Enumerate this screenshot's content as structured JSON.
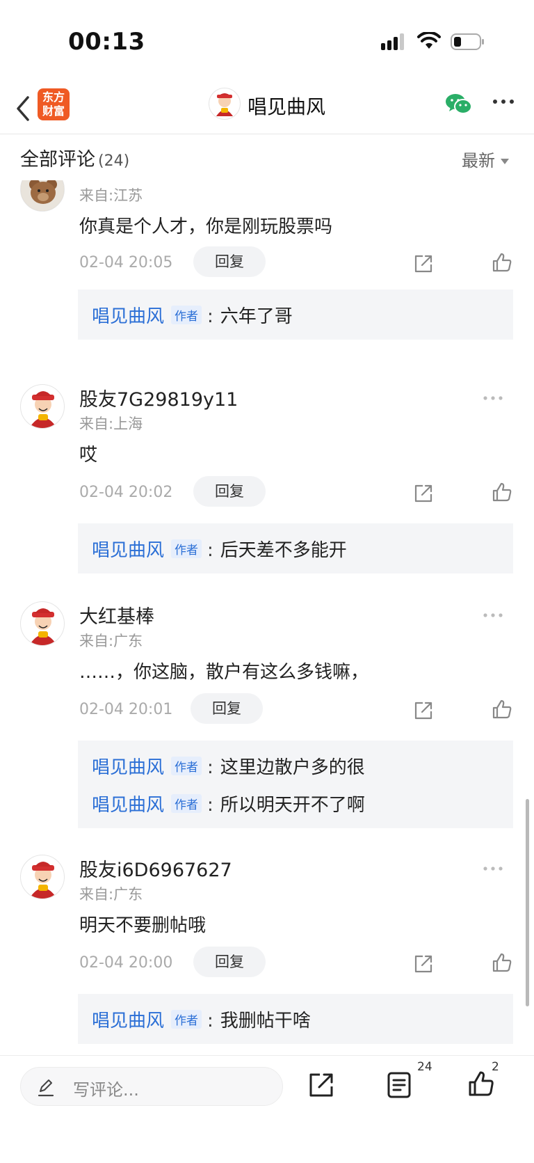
{
  "status": {
    "time": "00:13"
  },
  "nav": {
    "logo_line1": "东方",
    "logo_line2": "财富",
    "title": "唱见曲风"
  },
  "header": {
    "title": "全部评论",
    "count": "(24)",
    "sort": "最新"
  },
  "comments": [
    {
      "name": "",
      "location": "来自:江苏",
      "text": "你真是个人才，你是刚玩股票吗",
      "time": "02-04 20:05",
      "reply_label": "回复",
      "replies": [
        {
          "name": "唱见曲风",
          "tag": "作者",
          "colon": ":",
          "text": "六年了哥"
        }
      ]
    },
    {
      "name": "股友7G29819y11",
      "location": "来自:上海",
      "text": "哎",
      "time": "02-04 20:02",
      "reply_label": "回复",
      "replies": [
        {
          "name": "唱见曲风",
          "tag": "作者",
          "colon": ":",
          "text": "后天差不多能开"
        }
      ]
    },
    {
      "name": "大红基棒",
      "location": "来自:广东",
      "text": "……，你这脑，散户有这么多钱嘛，",
      "time": "02-04 20:01",
      "reply_label": "回复",
      "replies": [
        {
          "name": "唱见曲风",
          "tag": "作者",
          "colon": ":",
          "text": "这里边散户多的很"
        },
        {
          "name": "唱见曲风",
          "tag": "作者",
          "colon": ":",
          "text": "所以明天开不了啊"
        }
      ]
    },
    {
      "name": "股友i6D6967627",
      "location": "来自:广东",
      "text": "明天不要删帖哦",
      "time": "02-04 20:00",
      "reply_label": "回复",
      "replies": [
        {
          "name": "唱见曲风",
          "tag": "作者",
          "colon": ":",
          "text": "我删帖干啥"
        }
      ]
    }
  ],
  "bottom": {
    "placeholder": "写评论...",
    "comment_count": "24",
    "like_count": "2"
  },
  "icons": {
    "back": "chevron-left-icon",
    "wechat": "wechat-icon",
    "more": "more-horizontal-icon",
    "share": "share-icon",
    "like": "thumbs-up-icon",
    "comments": "comment-list-icon",
    "pen": "pen-icon"
  },
  "colors": {
    "brand": "#ef5a24",
    "link": "#2b6fd6",
    "wechat": "#2aae67"
  }
}
